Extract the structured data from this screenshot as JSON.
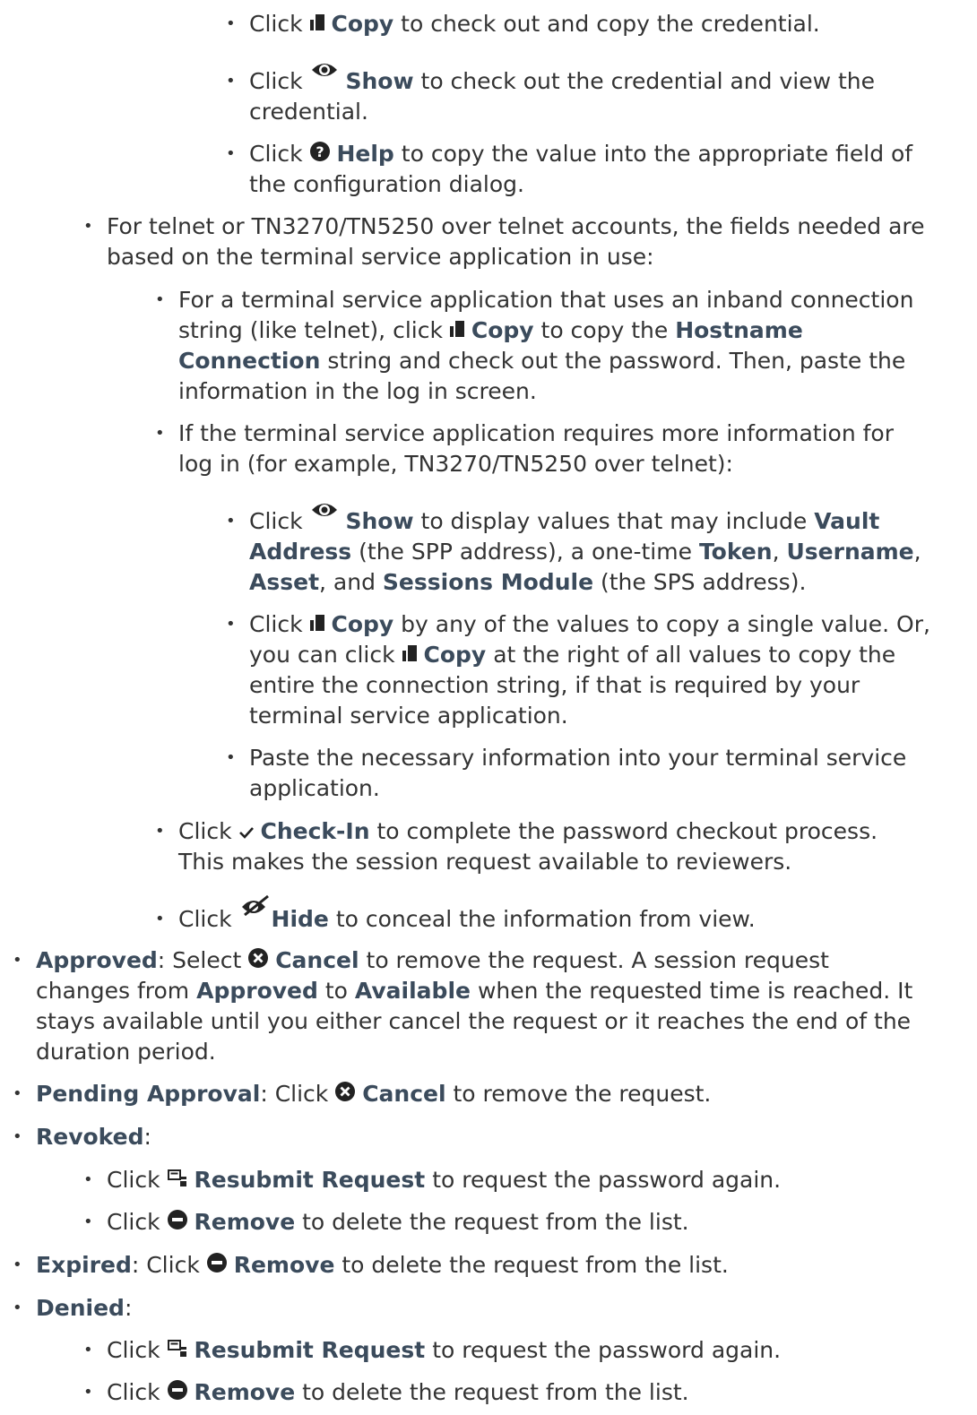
{
  "items": {
    "copy_check_out": {
      "pre": "Click",
      "btn": "Copy",
      "post": "to check out and copy the credential."
    },
    "show_check_out": {
      "pre": "Click",
      "btn": "Show",
      "post1": "to check out the credential and view the",
      "post2": "credential."
    },
    "help_copy": {
      "pre": "Click",
      "btn": "Help",
      "post1": "to copy the value into the appropriate field of",
      "post2": "the configuration dialog."
    },
    "telnet_intro": {
      "line1": "For telnet or TN3270/TN5250 over telnet accounts, the fields needed are",
      "line2": "based on the terminal service application in use:"
    },
    "inband": {
      "line1": "For a terminal service application that uses an inband connection",
      "l2_pre": "string (like telnet), click",
      "l2_btn": "Copy",
      "l2_post": "to copy the",
      "l2_term": "Hostname",
      "l3_term": "Connection",
      "l3_post": "string and check out the password. Then, paste the",
      "line4": "information in the log in screen."
    },
    "more_info": {
      "line1": "If the terminal service application requires more information for",
      "line2": "log in (for example, TN3270/TN5250 over telnet):"
    },
    "show_values": {
      "pre": "Click",
      "btn": "Show",
      "l1_post": "to display values that may include",
      "l1_term": "Vault",
      "l2_term1": "Address",
      "l2_mid1": "(the SPP address), a one-time",
      "l2_term2": "Token",
      "l2_sep": ",",
      "l2_term3": "Username",
      "l2_end": ",",
      "l3_term1": "Asset",
      "l3_mid": ", and",
      "l3_term2": "Sessions Module",
      "l3_post": "(the SPS address)."
    },
    "copy_values": {
      "pre": "Click",
      "btn": "Copy",
      "l1_post": "by any of the values to copy a single value. Or,",
      "l2_pre": "you can click",
      "l2_btn": "Copy",
      "l2_post": "at the right of all values to copy the",
      "line3": "entire the connection string, if that is required by your",
      "line4": "terminal service application."
    },
    "paste": {
      "line1": "Paste the necessary information into your terminal service",
      "line2": "application."
    },
    "check_in": {
      "pre": "Click",
      "btn": "Check-In",
      "post1": "to complete the password checkout process.",
      "line2": "This makes the session request available to reviewers."
    },
    "hide": {
      "pre": "Click",
      "btn": "Hide",
      "post": "to conceal the information from view."
    },
    "approved": {
      "term": "Approved",
      "l1_mid": ": Select",
      "btn": "Cancel",
      "l1_post": "to remove the request. A session request",
      "l2_pre": "changes from",
      "l2_term1": "Approved",
      "l2_mid": "to",
      "l2_term2": "Available",
      "l2_post": "when the requested time is reached. It",
      "line3": "stays available until you either cancel the request or it reaches the end of the",
      "line4": "duration period."
    },
    "pending": {
      "term": "Pending Approval",
      "mid": ": Click",
      "btn": "Cancel",
      "post": "to remove the request."
    },
    "revoked": {
      "term": "Revoked",
      "colon": ":"
    },
    "revoked_resubmit": {
      "pre": "Click",
      "btn": "Resubmit Request",
      "post": "to request the password again."
    },
    "revoked_remove": {
      "pre": "Click",
      "btn": "Remove",
      "post": "to delete the request from the list."
    },
    "expired": {
      "term": "Expired",
      "mid": ": Click",
      "btn": "Remove",
      "post": "to delete the request from the list."
    },
    "denied": {
      "term": "Denied",
      "colon": ":"
    },
    "denied_resubmit": {
      "pre": "Click",
      "btn": "Resubmit Request",
      "post": "to request the password again."
    },
    "denied_remove": {
      "pre": "Click",
      "btn": "Remove",
      "post": "to delete the request from the list."
    }
  },
  "icons": {
    "copy": "copy-icon",
    "show": "eye-icon",
    "help": "question-circle-icon",
    "check": "checkmark-icon",
    "hide": "eye-slash-icon",
    "cancel": "x-circle-icon",
    "resubmit": "resubmit-icon",
    "remove": "minus-circle-icon"
  },
  "colors": {
    "text": "#333333",
    "emphasis": "#3b4b5c"
  }
}
